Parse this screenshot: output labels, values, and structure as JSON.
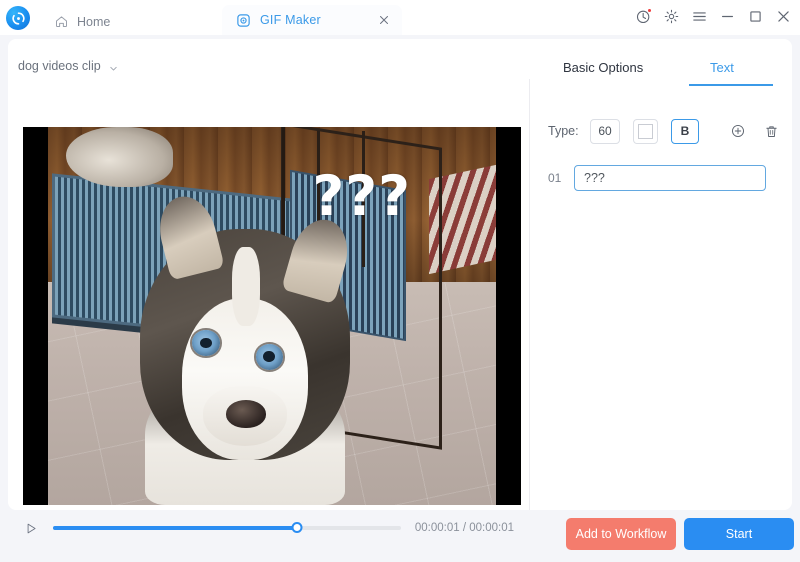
{
  "titlebar": {
    "logo_icon": "app-logo-swirl-icon",
    "home": {
      "label": "Home",
      "icon": "home-icon"
    },
    "tab": {
      "label": "GIF Maker",
      "icon": "gif-maker-icon",
      "close_icon": "close-icon"
    },
    "controls": [
      {
        "name": "history-clock-icon",
        "badge": true
      },
      {
        "name": "settings-gear-icon",
        "badge": false
      },
      {
        "name": "menu-hamburger-icon",
        "badge": false
      },
      {
        "name": "minimize-icon",
        "badge": false
      },
      {
        "name": "maximize-icon",
        "badge": false
      },
      {
        "name": "close-window-icon",
        "badge": false
      }
    ]
  },
  "preview": {
    "clip_name": "dog videos clip",
    "dropdown_icon": "chevron-down-icon",
    "overlay_text": "???",
    "play_icon": "play-icon",
    "progress_percent": 70,
    "time_display": "00:00:01 / 00:00:01",
    "current_time": "00:00:01",
    "total_time": "00:00:01"
  },
  "panel": {
    "tabs": [
      {
        "label": "Basic Options",
        "active": false
      },
      {
        "label": "Text",
        "active": true
      }
    ],
    "type_label": "Type:",
    "font_size": "60",
    "font_color": "#ffffff",
    "bold_label": "B",
    "bold_active": true,
    "add_icon": "add-circle-icon",
    "delete_icon": "trash-icon",
    "rows": [
      {
        "index": "01",
        "value": "???",
        "placeholder": ""
      }
    ]
  },
  "footer": {
    "add_to_workflow": "Add to Workflow",
    "start": "Start"
  },
  "colors": {
    "accent_blue": "#2a8df2",
    "tab_blue": "#3b9ae8",
    "coral": "#f47c6d",
    "page_bg": "#f4f5f9",
    "badge_red": "#ef3b3b"
  }
}
